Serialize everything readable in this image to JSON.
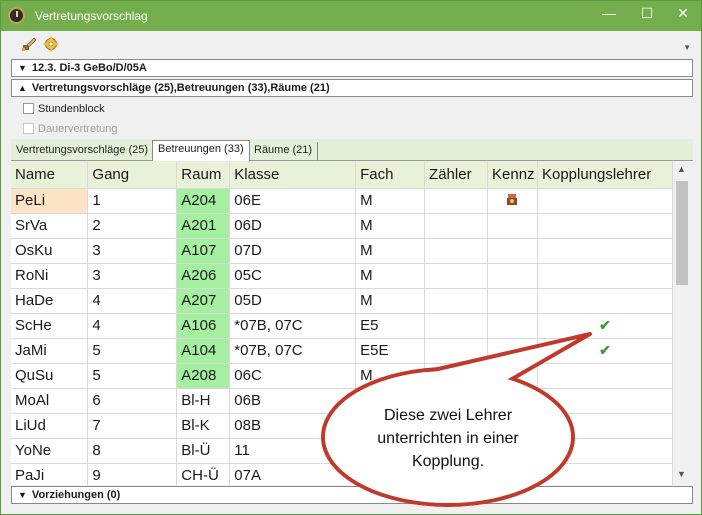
{
  "window": {
    "title": "Vertretungsvorschlag",
    "minimize_glyph": "—",
    "maximize_glyph": "☐",
    "close_glyph": "✕"
  },
  "toolbar": {
    "icons": [
      "paint-brush-icon",
      "gear-icon"
    ],
    "collapse_glyph": "▼"
  },
  "sections": {
    "lesson": {
      "label": "12.3. Di-3 GeBo/D/05A",
      "arrow": "▼"
    },
    "suggestions": {
      "label": "Vertretungsvorschläge (25),Betreuungen (33),Räume (21)",
      "arrow": "▲"
    },
    "advance": {
      "label": "Vorziehungen (0)",
      "arrow": "▼"
    }
  },
  "options": {
    "stundenblock": "Stundenblock",
    "dauervertretung": "Dauervertretung"
  },
  "tabs": [
    {
      "label": "Vertretungsvorschläge (25)"
    },
    {
      "label": "Betreuungen (33)"
    },
    {
      "label": "Räume (21)"
    }
  ],
  "table": {
    "columns": [
      "Name",
      "Gang",
      "Raum",
      "Klasse",
      "Fach",
      "Zähler",
      "Kennz",
      "Kopplungslehrer"
    ],
    "rows": [
      {
        "name": "PeLi",
        "gang": "1",
        "raum": "A204",
        "klasse": "06E",
        "fach": "M",
        "zaehler": "",
        "kennz": "flag",
        "kopplung": ""
      },
      {
        "name": "SrVa",
        "gang": "2",
        "raum": "A201",
        "klasse": "06D",
        "fach": "M",
        "zaehler": "",
        "kennz": "",
        "kopplung": ""
      },
      {
        "name": "OsKu",
        "gang": "3",
        "raum": "A107",
        "klasse": "07D",
        "fach": "M",
        "zaehler": "",
        "kennz": "",
        "kopplung": ""
      },
      {
        "name": "RoNi",
        "gang": "3",
        "raum": "A206",
        "klasse": "05C",
        "fach": "M",
        "zaehler": "",
        "kennz": "",
        "kopplung": ""
      },
      {
        "name": "HaDe",
        "gang": "4",
        "raum": "A207",
        "klasse": "05D",
        "fach": "M",
        "zaehler": "",
        "kennz": "",
        "kopplung": ""
      },
      {
        "name": "ScHe",
        "gang": "4",
        "raum": "A106",
        "klasse": "*07B, 07C",
        "fach": "E5",
        "zaehler": "",
        "kennz": "",
        "kopplung": "✔"
      },
      {
        "name": "JaMi",
        "gang": "5",
        "raum": "A104",
        "klasse": "*07B, 07C",
        "fach": "E5E",
        "zaehler": "",
        "kennz": "",
        "kopplung": "✔"
      },
      {
        "name": "QuSu",
        "gang": "5",
        "raum": "A208",
        "klasse": "06C",
        "fach": "M",
        "zaehler": "",
        "kennz": "",
        "kopplung": ""
      },
      {
        "name": "MoAl",
        "gang": "6",
        "raum": "Bl-H",
        "klasse": "06B",
        "fach": "",
        "zaehler": "",
        "kennz": "",
        "kopplung": ""
      },
      {
        "name": "LiUd",
        "gang": "7",
        "raum": "Bl-K",
        "klasse": "08B",
        "fach": "",
        "zaehler": "",
        "kennz": "",
        "kopplung": ""
      },
      {
        "name": "YoNe",
        "gang": "8",
        "raum": "Bl-Ü",
        "klasse": "11",
        "fach": "",
        "zaehler": "",
        "kennz": "",
        "kopplung": ""
      },
      {
        "name": "PaJi",
        "gang": "9",
        "raum": "CH-Ü",
        "klasse": "07A",
        "fach": "",
        "zaehler": "",
        "kennz": "",
        "kopplung": ""
      }
    ]
  },
  "callout": {
    "line1": "Diese zwei Lehrer",
    "line2": "unterrichten in einer",
    "line3": "Kopplung."
  },
  "colors": {
    "titlebar": "#74ad4c",
    "room_green": "#a5f0a0",
    "selected_name": "#fde3c5",
    "check_green": "#3a9b3a",
    "callout_fill": "#ffffff",
    "callout_border": "#c0392b"
  }
}
